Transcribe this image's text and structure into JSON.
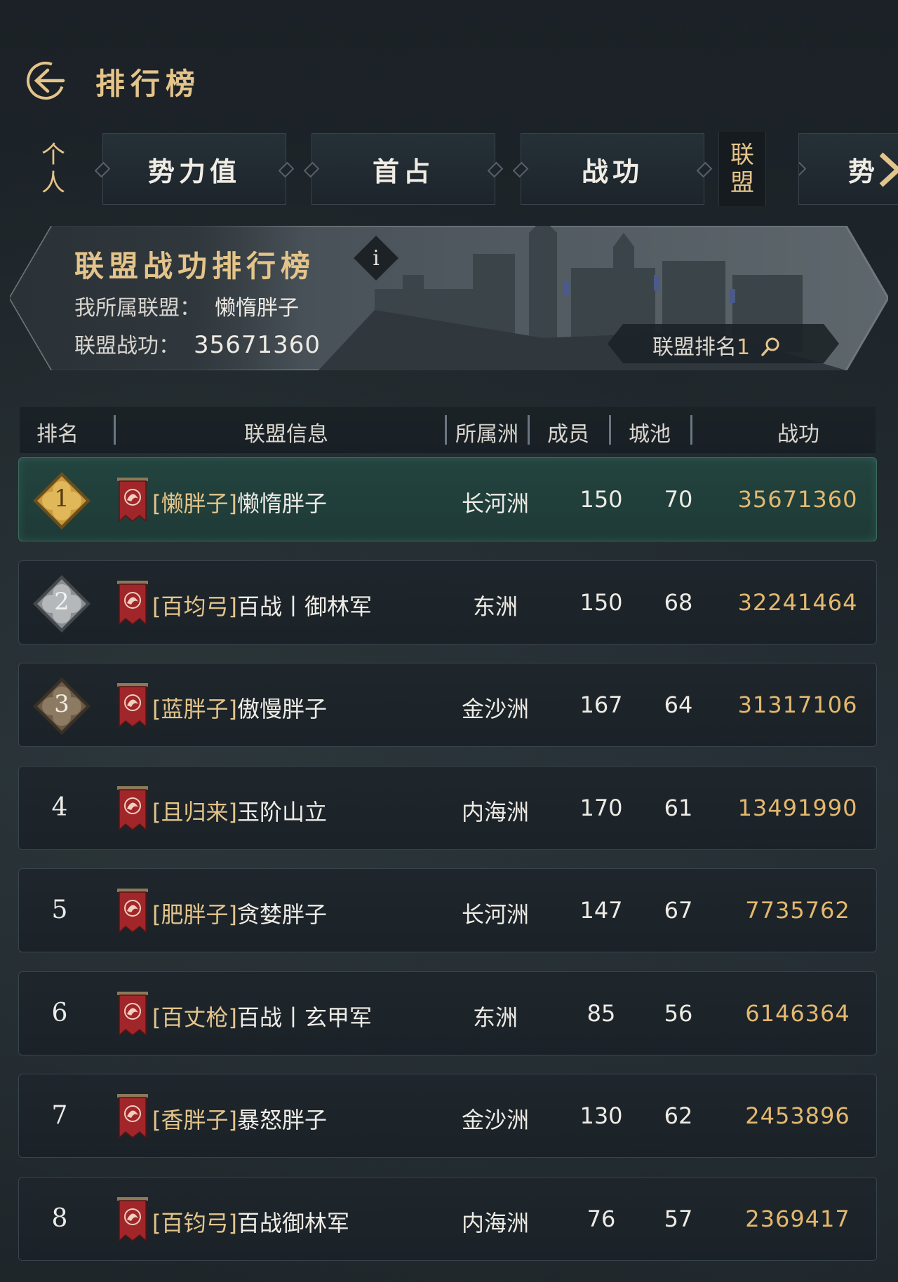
{
  "header": {
    "title": "排行榜"
  },
  "tabs": {
    "personal_chars": [
      "个",
      "人"
    ],
    "items": [
      "势力值",
      "首占",
      "战功"
    ],
    "alliance_chars": [
      "联",
      "盟"
    ],
    "partial": "势"
  },
  "banner": {
    "title": "联盟战功排行榜",
    "info": "i",
    "my_alliance_label": "我所属联盟：",
    "my_alliance_value": "懒惰胖子",
    "power_label": "联盟战功：",
    "power_value": "35671360",
    "rank_label": "联盟排名",
    "rank_value": "1"
  },
  "table": {
    "headers": {
      "rank": "排名",
      "info": "联盟信息",
      "region": "所属洲",
      "members": "成员",
      "cities": "城池",
      "power": "战功"
    },
    "rows": [
      {
        "rank": "1",
        "tag": "[懒胖子]",
        "name": "懒惰胖子",
        "region": "长河洲",
        "members": "150",
        "cities": "70",
        "power": "35671360"
      },
      {
        "rank": "2",
        "tag": "[百均弓]",
        "name": "百战丨御林军",
        "region": "东洲",
        "members": "150",
        "cities": "68",
        "power": "32241464"
      },
      {
        "rank": "3",
        "tag": "[蓝胖子]",
        "name": "傲慢胖子",
        "region": "金沙洲",
        "members": "167",
        "cities": "64",
        "power": "31317106"
      },
      {
        "rank": "4",
        "tag": "[且归来]",
        "name": "玉阶山立",
        "region": "内海洲",
        "members": "170",
        "cities": "61",
        "power": "13491990"
      },
      {
        "rank": "5",
        "tag": "[肥胖子]",
        "name": "贪婪胖子",
        "region": "长河洲",
        "members": "147",
        "cities": "67",
        "power": "7735762"
      },
      {
        "rank": "6",
        "tag": "[百丈枪]",
        "name": "百战丨玄甲军",
        "region": "东洲",
        "members": "85",
        "cities": "56",
        "power": "6146364"
      },
      {
        "rank": "7",
        "tag": "[香胖子]",
        "name": "暴怒胖子",
        "region": "金沙洲",
        "members": "130",
        "cities": "62",
        "power": "2453896"
      },
      {
        "rank": "8",
        "tag": "[百钧弓]",
        "name": "百战御林军",
        "region": "内海洲",
        "members": "76",
        "cities": "57",
        "power": "2369417"
      }
    ]
  },
  "colors": {
    "gold": "#e4c48a",
    "power": "#e4b86e",
    "highlight_row": "#23443f"
  }
}
